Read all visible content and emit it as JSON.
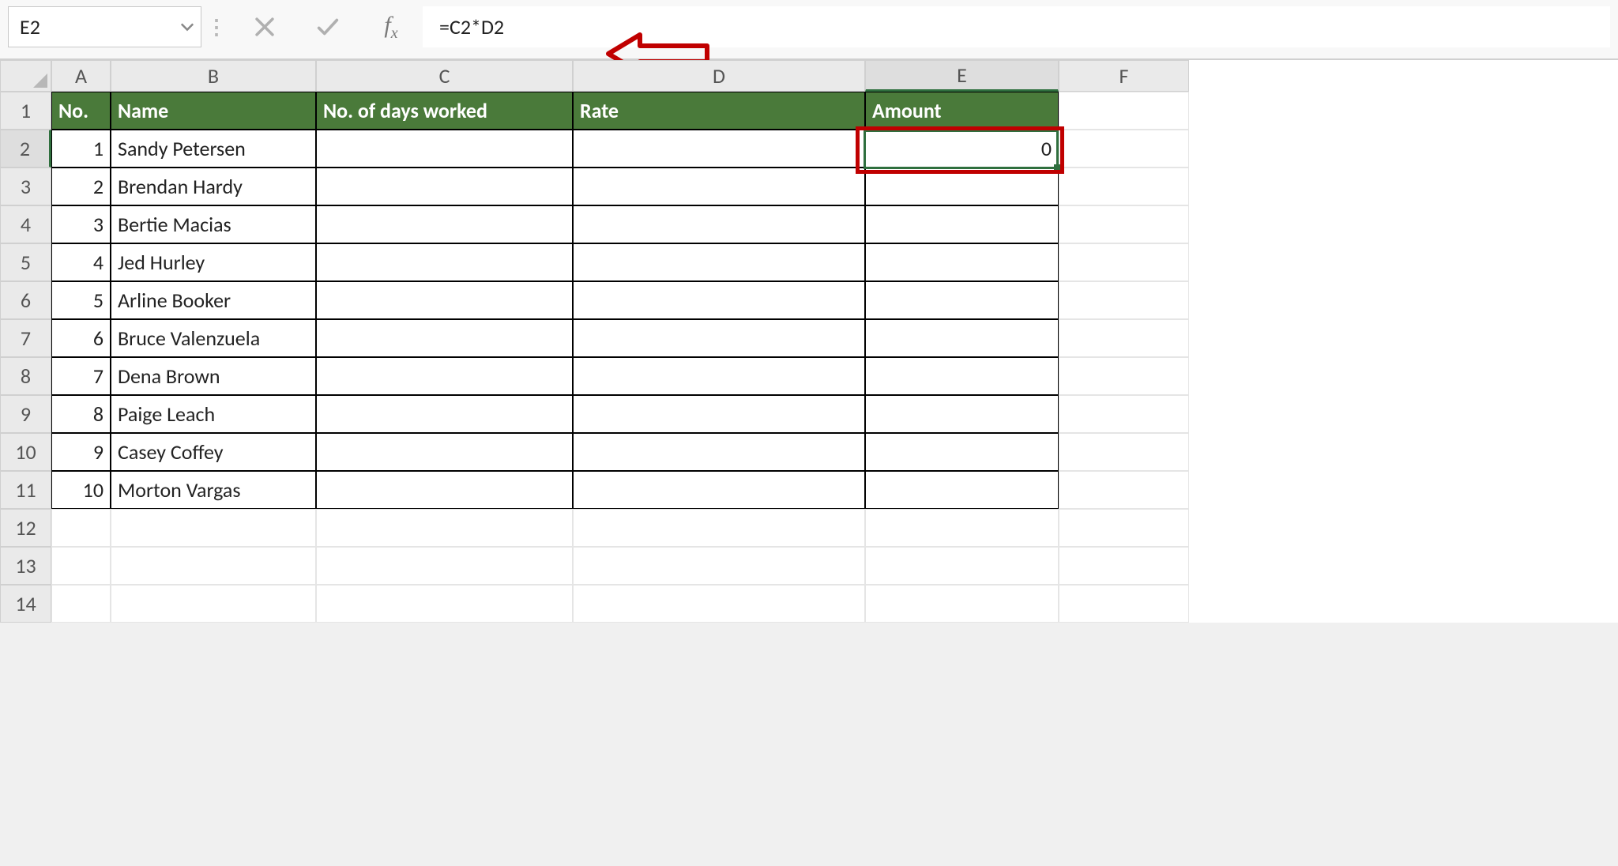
{
  "formula_bar": {
    "cell_ref": "E2",
    "formula": "=C2*D2",
    "fx_label": "f",
    "fx_sub": "x",
    "separator": "⋮"
  },
  "columns": [
    "A",
    "B",
    "C",
    "D",
    "E",
    "F"
  ],
  "header": {
    "no": "No.",
    "name": "Name",
    "days": "No. of days worked",
    "rate": "Rate",
    "amount": "Amount"
  },
  "rows": [
    {
      "no": "1",
      "name": "Sandy Petersen",
      "days": "",
      "rate": "",
      "amount": "0"
    },
    {
      "no": "2",
      "name": "Brendan Hardy",
      "days": "",
      "rate": "",
      "amount": ""
    },
    {
      "no": "3",
      "name": "Bertie Macias",
      "days": "",
      "rate": "",
      "amount": ""
    },
    {
      "no": "4",
      "name": "Jed Hurley",
      "days": "",
      "rate": "",
      "amount": ""
    },
    {
      "no": "5",
      "name": "Arline Booker",
      "days": "",
      "rate": "",
      "amount": ""
    },
    {
      "no": "6",
      "name": "Bruce Valenzuela",
      "days": "",
      "rate": "",
      "amount": ""
    },
    {
      "no": "7",
      "name": "Dena Brown",
      "days": "",
      "rate": "",
      "amount": ""
    },
    {
      "no": "8",
      "name": "Paige Leach",
      "days": "",
      "rate": "",
      "amount": ""
    },
    {
      "no": "9",
      "name": "Casey Coffey",
      "days": "",
      "rate": "",
      "amount": ""
    },
    {
      "no": "10",
      "name": "Morton Vargas",
      "days": "",
      "rate": "",
      "amount": ""
    }
  ],
  "empty_row_count": 3,
  "row_labels": [
    "1",
    "2",
    "3",
    "4",
    "5",
    "6",
    "7",
    "8",
    "9",
    "10",
    "11",
    "12",
    "13",
    "14"
  ]
}
